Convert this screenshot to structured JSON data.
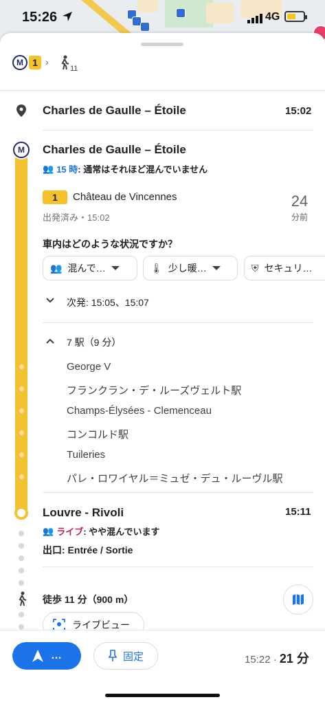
{
  "status_bar": {
    "time": "15:26",
    "network": "4G"
  },
  "summary": {
    "line": "1",
    "walk_minutes": "11"
  },
  "origin": {
    "name": "Charles de Gaulle – Étoile",
    "time": "15:02"
  },
  "board": {
    "station": "Charles de Gaulle – Étoile",
    "crowd_time": "15 時",
    "crowd_text": ": 通常はそれほど混んでいません",
    "line": "1",
    "direction": "Château de Vincennes",
    "departed": "出発済み・15:02",
    "minutes_ago": "24",
    "minutes_ago_unit": "分前"
  },
  "feedback": {
    "question": "車内はどのような状況ですか？",
    "chips": [
      {
        "label": "混んで…",
        "icon": "people-icon"
      },
      {
        "label": "少し暖…",
        "icon": "thermometer-icon"
      },
      {
        "label": "セキュリ…",
        "icon": "shield-icon"
      }
    ]
  },
  "next_departures": "次発: 15:05、15:07",
  "stops_summary": "7 駅（9 分）",
  "stops": [
    "George V",
    "フランクラン・デ・ルーズヴェルト駅",
    "Champs-Élysées - Clemenceau",
    "コンコルド駅",
    "Tuileries",
    "パレ・ロワイヤル＝ミュゼ・デュ・ルーヴル駅"
  ],
  "arrival": {
    "station": "Louvre - Rivoli",
    "time": "15:11",
    "live_label": "ライブ",
    "live_text": ": やや混んでいます",
    "exit": "出口: Entrée / Sortie"
  },
  "walk": {
    "text": "徒歩 11 分（900 m）",
    "live_view": "ライブビュー"
  },
  "bottom": {
    "start_label": "…",
    "pin_label": "固定",
    "arrival_time": "15:22",
    "separator": " · ",
    "duration": "21 分"
  },
  "colors": {
    "accent": "#1a73e8",
    "line1": "#f6c22b",
    "live": "#c2185b"
  }
}
